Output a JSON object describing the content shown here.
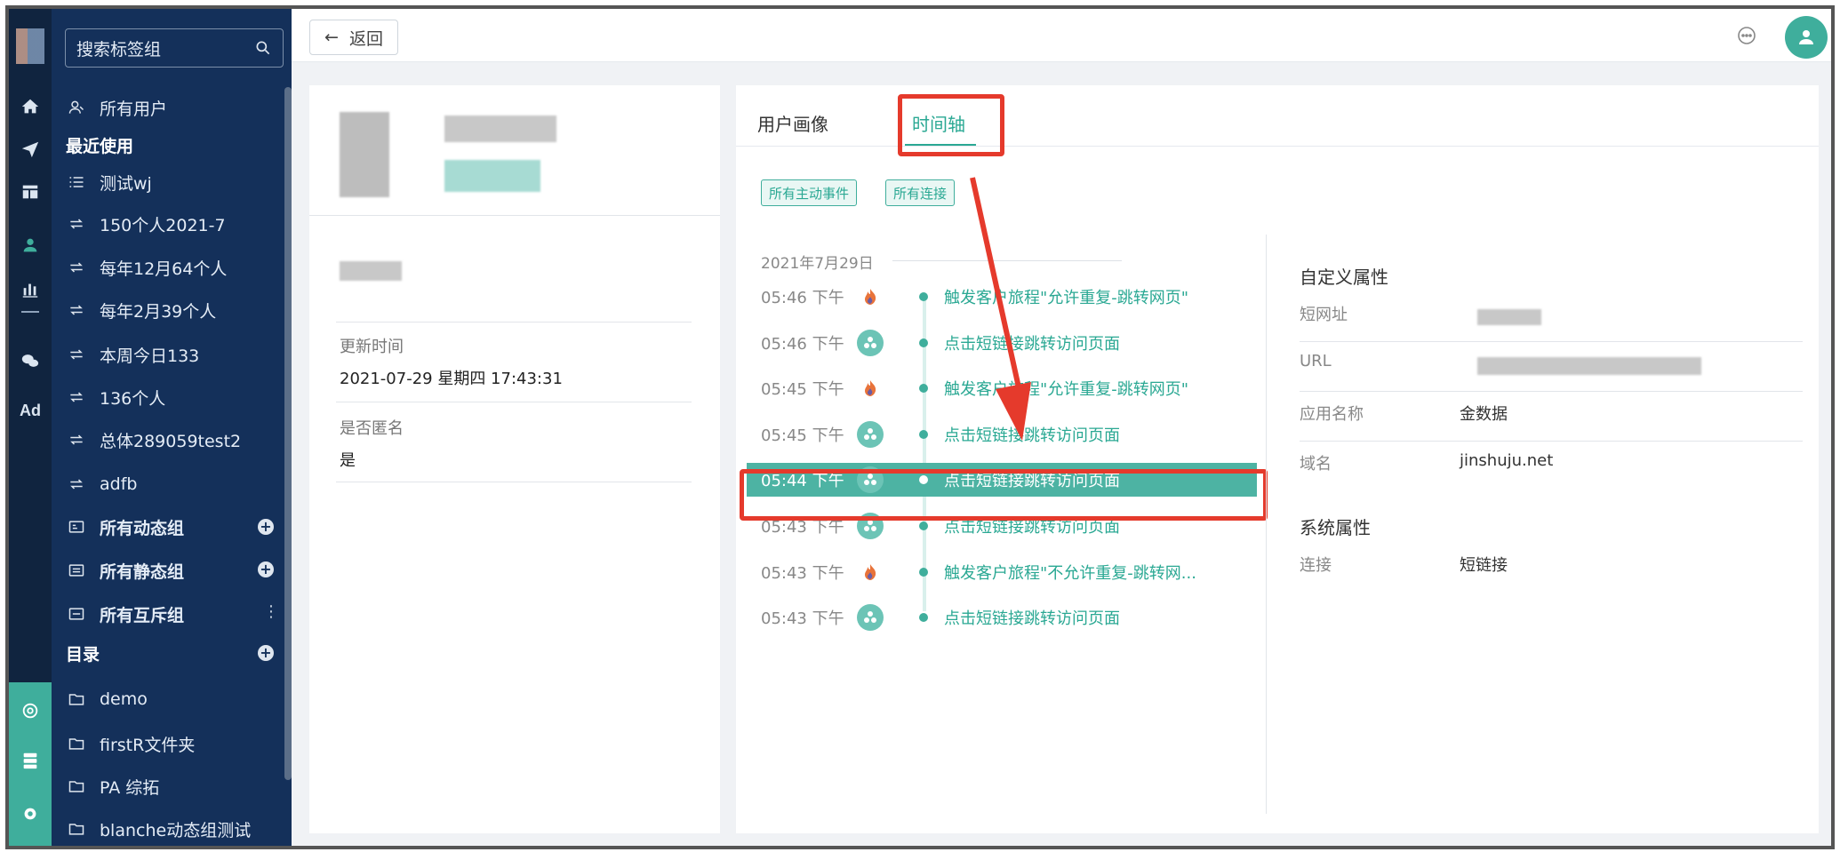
{
  "search": {
    "placeholder": "搜索标签组"
  },
  "nav": {
    "all_users": "所有用户",
    "recent_heading": "最近使用",
    "recent": [
      "测试wj",
      "150个人2021-7",
      "每年12月64个人",
      "每年2月39个人",
      "本周今日133",
      "136个人",
      "总体289059test2",
      "adfb"
    ],
    "groups": [
      "所有动态组",
      "所有静态组",
      "所有互斥组"
    ],
    "catalog_heading": "目录",
    "folders": [
      "demo",
      "firstR文件夹",
      "PA 综拓",
      "blanche动态组测试"
    ]
  },
  "rail": {
    "ad_label": "Ad"
  },
  "topbar": {
    "back_label": "返回"
  },
  "profile": {
    "update_time_label": "更新时间",
    "update_time_value": "2021-07-29 星期四 17:43:31",
    "anonymous_label": "是否匿名",
    "anonymous_value": "是"
  },
  "tabs": {
    "portrait": "用户画像",
    "timeline": "时间轴"
  },
  "filters": [
    "所有主动事件",
    "所有连接"
  ],
  "timeline": {
    "date": "2021年7月29日",
    "events": [
      {
        "time": "05:46 下午",
        "icon": "flame-icon",
        "text": "触发客户旅程\"允许重复-跳转网页\"",
        "highlighted": false
      },
      {
        "time": "05:46 下午",
        "icon": "link-circle-icon",
        "text": "点击短链接跳转访问页面",
        "highlighted": false
      },
      {
        "time": "05:45 下午",
        "icon": "flame-icon",
        "text": "触发客户旅程\"允许重复-跳转网页\"",
        "highlighted": false
      },
      {
        "time": "05:45 下午",
        "icon": "link-circle-icon",
        "text": "点击短链接跳转访问页面",
        "highlighted": false
      },
      {
        "time": "05:44 下午",
        "icon": "link-circle-icon",
        "text": "点击短链接跳转访问页面",
        "highlighted": true
      },
      {
        "time": "05:43 下午",
        "icon": "link-circle-icon",
        "text": "点击短链接跳转访问页面",
        "highlighted": false
      },
      {
        "time": "05:43 下午",
        "icon": "flame-icon",
        "text": "触发客户旅程\"不允许重复-跳转网...",
        "highlighted": false
      },
      {
        "time": "05:43 下午",
        "icon": "link-circle-icon",
        "text": "点击短链接跳转访问页面",
        "highlighted": false
      }
    ]
  },
  "properties": {
    "custom_title": "自定义属性",
    "custom": [
      {
        "label": "短网址",
        "value": ""
      },
      {
        "label": "URL",
        "value": ""
      },
      {
        "label": "应用名称",
        "value": "金数据"
      },
      {
        "label": "域名",
        "value": "jinshuju.net"
      }
    ],
    "system_title": "系统属性",
    "system": [
      {
        "label": "连接",
        "value": "短链接"
      }
    ]
  },
  "colors": {
    "accent": "#3fae9c",
    "nav_bg": "#14305a",
    "rail_bg": "#10243f",
    "annotation_red": "#e53a2c"
  }
}
